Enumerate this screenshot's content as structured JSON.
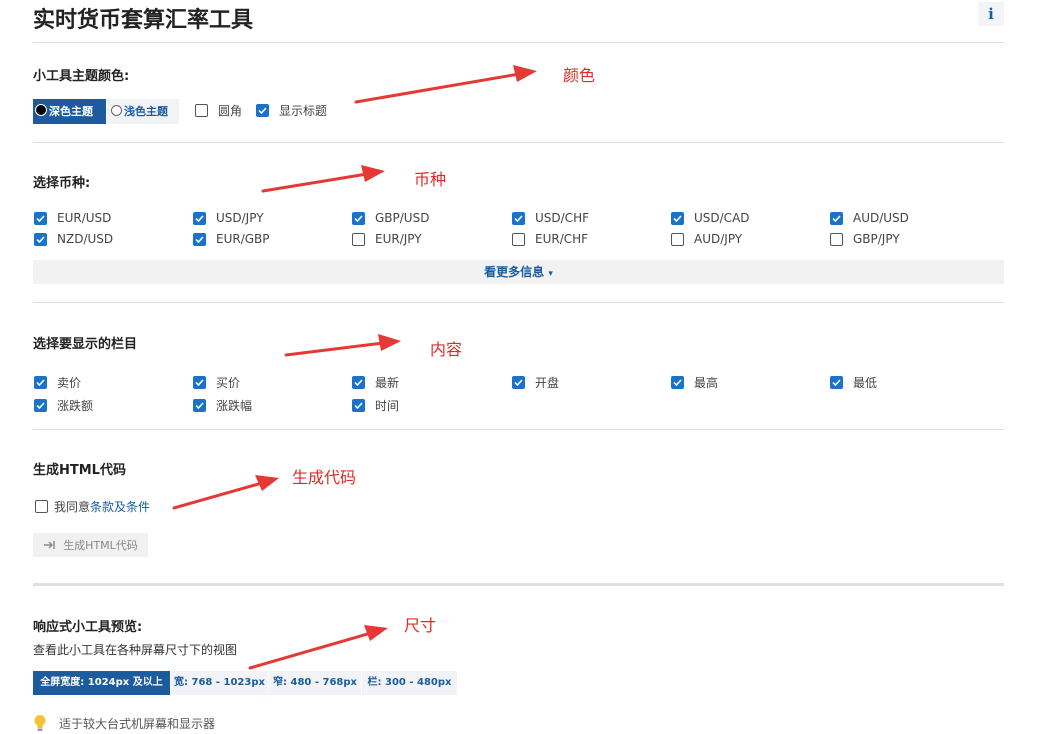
{
  "header": {
    "title": "实时货币套算汇率工具",
    "info": "i"
  },
  "theme_section": {
    "title": "小工具主题颜色:",
    "dark_label": "深色主题",
    "light_label": "浅色主题",
    "options": [
      {
        "label": "圆角",
        "checked": false
      },
      {
        "label": "显示标题",
        "checked": true
      }
    ]
  },
  "currency_section": {
    "title": "选择币种:",
    "pairs": [
      {
        "label": "EUR/USD",
        "checked": true
      },
      {
        "label": "USD/JPY",
        "checked": true
      },
      {
        "label": "GBP/USD",
        "checked": true
      },
      {
        "label": "USD/CHF",
        "checked": true
      },
      {
        "label": "USD/CAD",
        "checked": true
      },
      {
        "label": "AUD/USD",
        "checked": true
      },
      {
        "label": "NZD/USD",
        "checked": true
      },
      {
        "label": "EUR/GBP",
        "checked": true
      },
      {
        "label": "EUR/JPY",
        "checked": false
      },
      {
        "label": "EUR/CHF",
        "checked": false
      },
      {
        "label": "AUD/JPY",
        "checked": false
      },
      {
        "label": "GBP/JPY",
        "checked": false
      }
    ],
    "more_label": "看更多信息"
  },
  "columns_section": {
    "title": "选择要显示的栏目",
    "columns": [
      {
        "label": "卖价",
        "checked": true
      },
      {
        "label": "买价",
        "checked": true
      },
      {
        "label": "最新",
        "checked": true
      },
      {
        "label": "开盘",
        "checked": true
      },
      {
        "label": "最高",
        "checked": true
      },
      {
        "label": "最低",
        "checked": true
      },
      {
        "label": "涨跌额",
        "checked": true
      },
      {
        "label": "涨跌幅",
        "checked": true
      },
      {
        "label": "时间",
        "checked": true
      }
    ]
  },
  "generate_section": {
    "title": "生成HTML代码",
    "agree_prefix": "我同意",
    "terms_link": "条款及条件",
    "agree_checked": false,
    "button_label": "生成HTML代码"
  },
  "preview_section": {
    "title": "响应式小工具预览:",
    "description": "查看此小工具在各种屏幕尺寸下的视图",
    "sizes": [
      {
        "label": "全屏宽度: 1024px 及以上",
        "active": true
      },
      {
        "label": "宽: 768 - 1023px",
        "active": false
      },
      {
        "label": "窄: 480 - 768px",
        "active": false
      },
      {
        "label": "栏: 300 - 480px",
        "active": false
      }
    ],
    "hint": "适于较大台式机屏幕和显示器"
  },
  "annotations": {
    "color": "颜色",
    "currency": "币种",
    "content": "内容",
    "code": "生成代码",
    "size": "尺寸",
    "annotation_color_hex": "#e02a2a"
  },
  "colors": {
    "accent": "#1c5c9e",
    "checkbox": "#1a73c9"
  }
}
